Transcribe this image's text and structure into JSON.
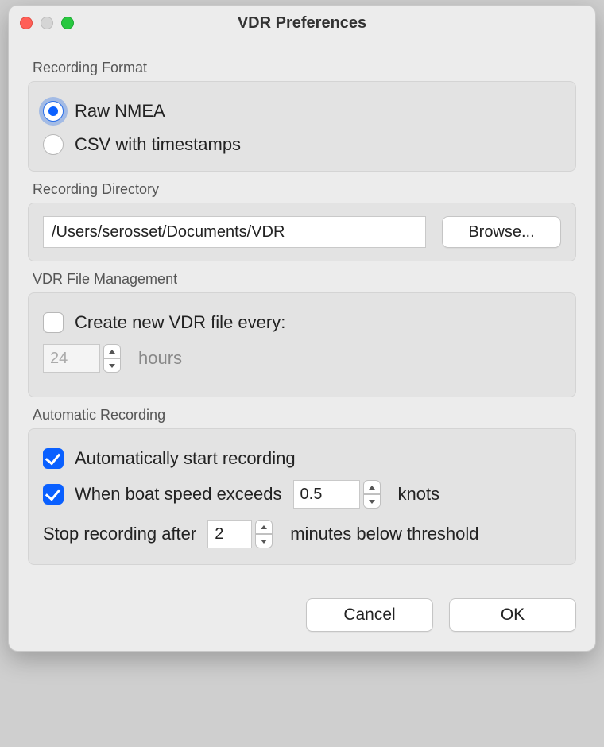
{
  "window": {
    "title": "VDR Preferences"
  },
  "recording_format": {
    "label": "Recording Format",
    "options": {
      "raw_nmea": "Raw NMEA",
      "csv_ts": "CSV with timestamps"
    },
    "selected": "raw_nmea"
  },
  "recording_directory": {
    "label": "Recording Directory",
    "path": "/Users/serosset/Documents/VDR",
    "browse": "Browse..."
  },
  "file_management": {
    "label": "VDR File Management",
    "create_new": {
      "text": "Create new VDR file every:",
      "checked": false,
      "interval": "24",
      "unit": "hours"
    }
  },
  "automatic_recording": {
    "label": "Automatic Recording",
    "auto_start": {
      "text": "Automatically start recording",
      "checked": true
    },
    "speed_exceeds": {
      "text": "When boat speed exceeds",
      "checked": true,
      "value": "0.5",
      "unit": "knots"
    },
    "stop_after": {
      "prefix": "Stop recording after",
      "value": "2",
      "suffix": "minutes below threshold"
    }
  },
  "footer": {
    "cancel": "Cancel",
    "ok": "OK"
  }
}
